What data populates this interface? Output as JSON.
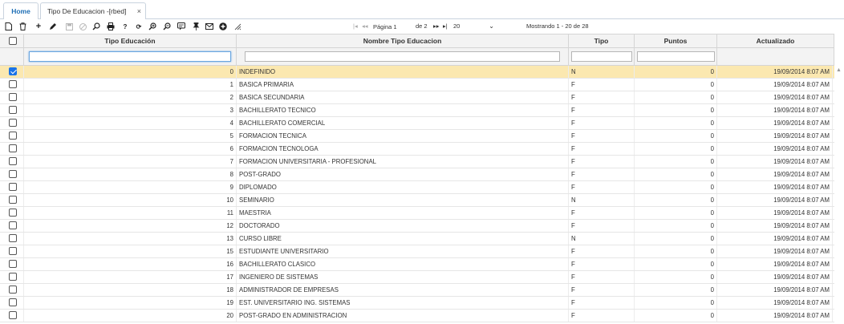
{
  "tabs": {
    "home": "Home",
    "active": "Tipo De Educacion -[rbed]",
    "close": "×"
  },
  "toolbar": {
    "icons": [
      "new-doc-icon",
      "trash-icon",
      "plus-icon",
      "pencil-icon",
      "save-icon",
      "cancel-icon",
      "search-icon",
      "print-icon",
      "help-icon",
      "refresh-icon",
      "zoom-in-icon",
      "zoom-out-icon",
      "comment-icon",
      "pin-icon",
      "mail-icon",
      "add-circle-icon",
      "resize-icon"
    ],
    "pager": {
      "first": "|◂",
      "prev": "◂◂",
      "page_label": "Página 1",
      "of_label": "de 2",
      "next": "▸▸",
      "last": "▸|",
      "page_size": "20",
      "showing": "Mostrando 1 - 20 de 28"
    }
  },
  "grid": {
    "headers": {
      "code": "Tipo Educación",
      "name": "Nombre Tipo Educacion",
      "tipo": "Tipo",
      "puntos": "Puntos",
      "actualizado": "Actualizado"
    },
    "rows": [
      {
        "code": "0",
        "name": "INDEFINIDO",
        "tipo": "N",
        "puntos": "0",
        "fecha": "19/09/2014 8:07 AM",
        "checked": true
      },
      {
        "code": "1",
        "name": "BASICA PRIMARIA",
        "tipo": "F",
        "puntos": "0",
        "fecha": "19/09/2014 8:07 AM",
        "checked": false
      },
      {
        "code": "2",
        "name": "BASICA SECUNDARIA",
        "tipo": "F",
        "puntos": "0",
        "fecha": "19/09/2014 8:07 AM",
        "checked": false
      },
      {
        "code": "3",
        "name": "BACHILLERATO TECNICO",
        "tipo": "F",
        "puntos": "0",
        "fecha": "19/09/2014 8:07 AM",
        "checked": false
      },
      {
        "code": "4",
        "name": "BACHILLERATO COMERCIAL",
        "tipo": "F",
        "puntos": "0",
        "fecha": "19/09/2014 8:07 AM",
        "checked": false
      },
      {
        "code": "5",
        "name": "FORMACION TECNICA",
        "tipo": "F",
        "puntos": "0",
        "fecha": "19/09/2014 8:07 AM",
        "checked": false
      },
      {
        "code": "6",
        "name": "FORMACION TECNOLOGA",
        "tipo": "F",
        "puntos": "0",
        "fecha": "19/09/2014 8:07 AM",
        "checked": false
      },
      {
        "code": "7",
        "name": "FORMACION UNIVERSITARIA - PROFESIONAL",
        "tipo": "F",
        "puntos": "0",
        "fecha": "19/09/2014 8:07 AM",
        "checked": false
      },
      {
        "code": "8",
        "name": "POST-GRADO",
        "tipo": "F",
        "puntos": "0",
        "fecha": "19/09/2014 8:07 AM",
        "checked": false
      },
      {
        "code": "9",
        "name": "DIPLOMADO",
        "tipo": "F",
        "puntos": "0",
        "fecha": "19/09/2014 8:07 AM",
        "checked": false
      },
      {
        "code": "10",
        "name": "SEMINARIO",
        "tipo": "N",
        "puntos": "0",
        "fecha": "19/09/2014 8:07 AM",
        "checked": false
      },
      {
        "code": "11",
        "name": "MAESTRIA",
        "tipo": "F",
        "puntos": "0",
        "fecha": "19/09/2014 8:07 AM",
        "checked": false
      },
      {
        "code": "12",
        "name": "DOCTORADO",
        "tipo": "F",
        "puntos": "0",
        "fecha": "19/09/2014 8:07 AM",
        "checked": false
      },
      {
        "code": "13",
        "name": "CURSO LIBRE",
        "tipo": "N",
        "puntos": "0",
        "fecha": "19/09/2014 8:07 AM",
        "checked": false
      },
      {
        "code": "15",
        "name": "ESTUDIANTE UNIVERSITARIO",
        "tipo": "F",
        "puntos": "0",
        "fecha": "19/09/2014 8:07 AM",
        "checked": false
      },
      {
        "code": "16",
        "name": "BACHILLERATO CLASICO",
        "tipo": "F",
        "puntos": "0",
        "fecha": "19/09/2014 8:07 AM",
        "checked": false
      },
      {
        "code": "17",
        "name": "INGENIERO DE SISTEMAS",
        "tipo": "F",
        "puntos": "0",
        "fecha": "19/09/2014 8:07 AM",
        "checked": false
      },
      {
        "code": "18",
        "name": "ADMINISTRADOR DE EMPRESAS",
        "tipo": "F",
        "puntos": "0",
        "fecha": "19/09/2014 8:07 AM",
        "checked": false
      },
      {
        "code": "19",
        "name": "EST. UNIVERSITARIO ING. SISTEMAS",
        "tipo": "F",
        "puntos": "0",
        "fecha": "19/09/2014 8:07 AM",
        "checked": false
      },
      {
        "code": "20",
        "name": "POST-GRADO EN ADMINISTRACION",
        "tipo": "F",
        "puntos": "0",
        "fecha": "19/09/2014 8:07 AM",
        "checked": false
      }
    ]
  },
  "colors": {
    "selected_row": "#fbe8b0",
    "home_tab": "#1f6fb5",
    "checkbox_checked": "#1a73e8"
  }
}
